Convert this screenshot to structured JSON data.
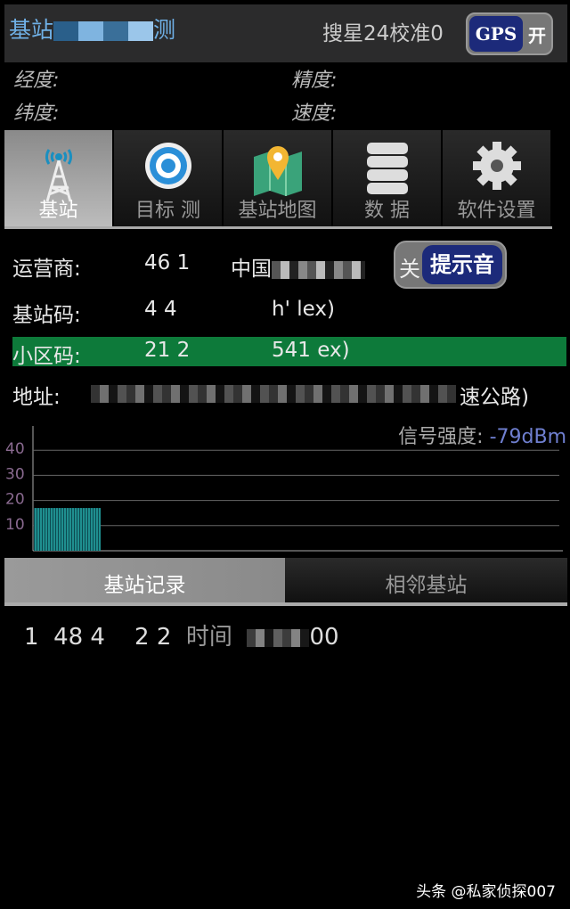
{
  "header": {
    "title_start": "基站",
    "title_end": "测",
    "status": "搜星24校准0",
    "gps_toggle": {
      "label": "GPS",
      "state_label": "开",
      "on": true
    }
  },
  "gps_info": {
    "longitude": "经度:",
    "latitude": "纬度:",
    "accuracy": "精度:",
    "speed": "速度:"
  },
  "tabs": [
    {
      "label": "基站",
      "icon": "cell-tower-icon",
      "active": true
    },
    {
      "label": "目标   测",
      "icon": "target-icon"
    },
    {
      "label": "基站地图",
      "icon": "map-pin-icon"
    },
    {
      "label": "数 据",
      "icon": "database-icon"
    },
    {
      "label": "软件设置",
      "icon": "gear-icon"
    }
  ],
  "info": {
    "operator": {
      "label": "运营商:",
      "value": "46  1",
      "name": "中国"
    },
    "lac": {
      "label": "基站码:",
      "value": "4    4",
      "hex": "h'      lex)"
    },
    "cell": {
      "label": "小区码:",
      "value": "21    2",
      "hex": "541     ex)"
    },
    "address": {
      "label": "地址:",
      "value_end": "速公路)"
    },
    "beep_toggle": {
      "off_label": "关",
      "label": "提示音",
      "on": true
    }
  },
  "signal": {
    "label": "信号强度:",
    "value": "-79dBm"
  },
  "chart_data": {
    "type": "bar",
    "yticks": [
      "40",
      "30",
      "20",
      "10"
    ],
    "ylim": [
      0,
      44
    ],
    "values": [
      17
    ],
    "bar_color": "#1f8f8f",
    "grid": true
  },
  "bottom_tabs": [
    {
      "label": "基站记录",
      "active": true
    },
    {
      "label": "相邻基站"
    }
  ],
  "records": [
    {
      "index": "1",
      "cid": "48  4",
      "lac": "2    2",
      "time_label": "时间",
      "time_end": "00"
    }
  ],
  "watermark": "头条 @私家侦探007",
  "colors": {
    "title": "#6fb0e6",
    "highlight": "#0d7a3a",
    "toggle": "#1c2a7a"
  }
}
